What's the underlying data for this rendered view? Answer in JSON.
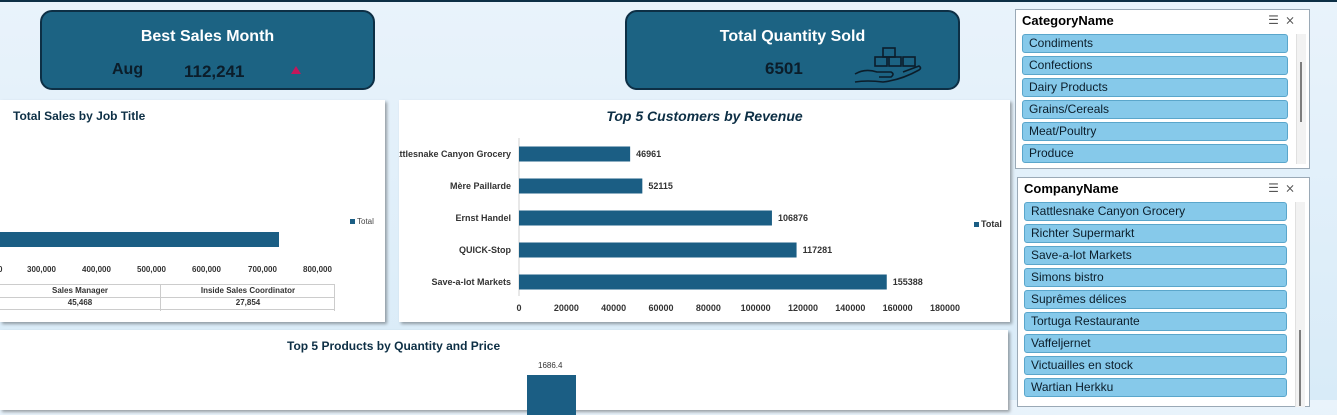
{
  "kpi_best_month": {
    "title": "Best Sales Month",
    "month": "Aug",
    "value": "112,241",
    "trend_icon": "triangle-up-icon"
  },
  "kpi_total_qty": {
    "title": "Total Quantity Sold",
    "value": "6501",
    "icon": "boxes-hand-icon"
  },
  "job_title_chart": {
    "title": "Total Sales by Job Title",
    "legend": "Total",
    "x_ticks": [
      "0",
      "300,000",
      "400,000",
      "500,000",
      "600,000",
      "700,000",
      "800,000"
    ],
    "table_headers": [
      "Sales Manager",
      "Inside Sales Coordinator"
    ],
    "table_values": [
      "45,468",
      "27,854"
    ]
  },
  "chart_data": {
    "type": "bar",
    "orientation": "horizontal",
    "title": "Top 5 Customers by Revenue",
    "categories": [
      "Rattlesnake Canyon Grocery",
      "Mère Paillarde",
      "Ernst Handel",
      "QUICK-Stop",
      "Save-a-lot Markets"
    ],
    "series": [
      {
        "name": "Total",
        "values": [
          46961,
          52115,
          106876,
          117281,
          155388
        ]
      }
    ],
    "value_labels": [
      "46961",
      "52115",
      "106876",
      "117281",
      "155388"
    ],
    "x_ticks": [
      "0",
      "20000",
      "40000",
      "60000",
      "80000",
      "100000",
      "120000",
      "140000",
      "160000",
      "180000"
    ],
    "xlim": [
      0,
      180000
    ],
    "legend": "right",
    "color": "#1b5e84"
  },
  "products_chart": {
    "title": "Top 5 Products by Quantity and Price",
    "visible_label": "1686.4"
  },
  "slicer_category": {
    "header": "CategoryName",
    "items": [
      "Condiments",
      "Confections",
      "Dairy Products",
      "Grains/Cereals",
      "Meat/Poultry",
      "Produce"
    ]
  },
  "slicer_company": {
    "header": "CompanyName",
    "items": [
      "Rattlesnake Canyon Grocery",
      "Richter Supermarkt",
      "Save-a-lot Markets",
      "Simons bistro",
      "Suprêmes délices",
      "Tortuga Restaurante",
      "Vaffeljernet",
      "Victuailles en stock",
      "Wartian Herkku"
    ]
  },
  "colors": {
    "kpi_bg": "#1c6383",
    "bar": "#1b5e84",
    "slicer_item": "#86c9ea",
    "accent_triangle": "#c2185b"
  }
}
